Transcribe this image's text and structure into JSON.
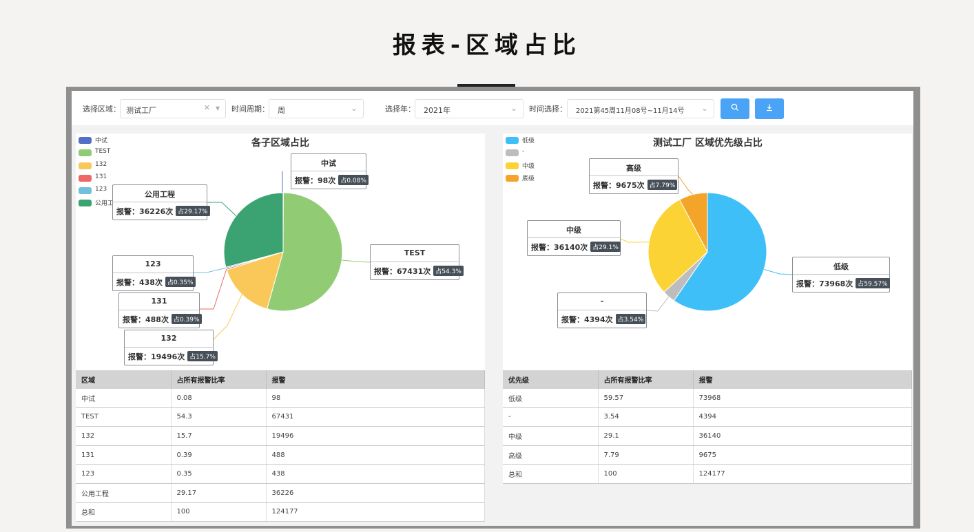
{
  "page": {
    "title": "报表-区域占比"
  },
  "toolbar": {
    "area_label": "选择区域：",
    "area_value": "测试工厂",
    "period_label": "时间周期：",
    "period_value": "周",
    "year_label": "选择年：",
    "year_value": "2021年",
    "time_label": "时间选择：",
    "time_value": "2021第45周11月08号~11月14号",
    "search_icon": "search-icon",
    "download_icon": "download-icon",
    "accent": "#4aa3f5"
  },
  "left": {
    "title": "各子区域占比",
    "value_prefix": "报警：",
    "count_suffix": "次",
    "pct_prefix": "占",
    "columns": [
      "区域",
      "占所有报警比率",
      "报警"
    ],
    "rows": [
      [
        "中试",
        "0.08",
        "98"
      ],
      [
        "TEST",
        "54.3",
        "67431"
      ],
      [
        "132",
        "15.7",
        "19496"
      ],
      [
        "131",
        "0.39",
        "488"
      ],
      [
        "123",
        "0.35",
        "438"
      ],
      [
        "公用工程",
        "29.17",
        "36226"
      ],
      [
        "总和",
        "100",
        "124177"
      ]
    ]
  },
  "right": {
    "title": "测试工厂 区域优先级占比",
    "value_prefix": "报警：",
    "count_suffix": "次",
    "pct_prefix": "占",
    "columns": [
      "优先级",
      "占所有报警比率",
      "报警"
    ],
    "rows": [
      [
        "低级",
        "59.57",
        "73968"
      ],
      [
        "-",
        "3.54",
        "4394"
      ],
      [
        "中级",
        "29.1",
        "36140"
      ],
      [
        "高级",
        "7.79",
        "9675"
      ],
      [
        "总和",
        "100",
        "124177"
      ]
    ]
  },
  "chart_data": [
    {
      "type": "pie",
      "title": "各子区域占比",
      "legend": [
        "中试",
        "TEST",
        "132",
        "131",
        "123",
        "公用工程"
      ],
      "legend_position": "top-left",
      "series": [
        {
          "name": "中试",
          "value": 98,
          "percent": "0.08%",
          "color": "#5470c6"
        },
        {
          "name": "TEST",
          "value": 67431,
          "percent": "54.3%",
          "color": "#91cc75"
        },
        {
          "name": "132",
          "value": 19496,
          "percent": "15.7%",
          "color": "#fac858"
        },
        {
          "name": "131",
          "value": 488,
          "percent": "0.39%",
          "color": "#ee6666"
        },
        {
          "name": "123",
          "value": 438,
          "percent": "0.35%",
          "color": "#73c0de"
        },
        {
          "name": "公用工程",
          "value": 36226,
          "percent": "29.17%",
          "color": "#3ba272"
        }
      ]
    },
    {
      "type": "pie",
      "title": "测试工厂 区域优先级占比",
      "legend": [
        "低级",
        "-",
        "中级",
        "底级"
      ],
      "legend_position": "top-left",
      "series": [
        {
          "name": "低级",
          "value": 73968,
          "percent": "59.57%",
          "color": "#3fbff8"
        },
        {
          "name": "-",
          "value": 4394,
          "percent": "3.54%",
          "color": "#bdbdbd"
        },
        {
          "name": "中级",
          "value": 36140,
          "percent": "29.1%",
          "color": "#fbd335"
        },
        {
          "name": "高级",
          "value": 9675,
          "percent": "7.79%",
          "color": "#f5a42a"
        }
      ]
    }
  ]
}
